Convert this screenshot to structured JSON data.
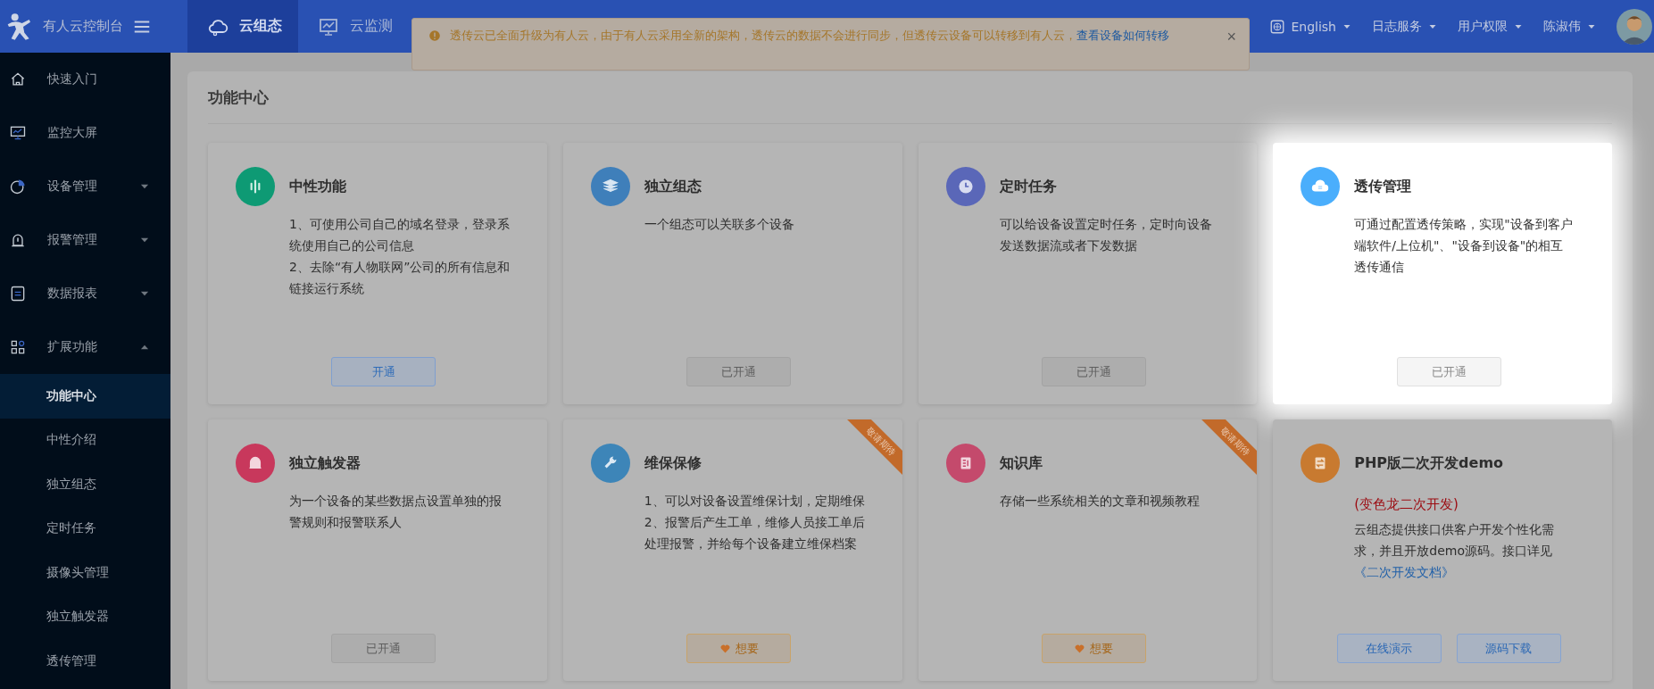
{
  "topbar": {
    "logo_text": "有人云控制台",
    "tabs": [
      {
        "label": "云组态",
        "selected": true
      },
      {
        "label": "云监测",
        "selected": false
      }
    ],
    "notice": {
      "text": "透传云已全面升级为有人云，由于有人云采用全新的架构，透传云的数据不会进行同步，但透传云设备可以转移到有人云，",
      "link": "查看设备如何转移",
      "close": "×"
    },
    "language": "English",
    "menus": [
      "日志服务",
      "用户权限",
      "陈淑伟"
    ]
  },
  "sidebar": {
    "items": [
      {
        "label": "快速入门"
      },
      {
        "label": "监控大屏"
      },
      {
        "label": "设备管理",
        "expanded": false
      },
      {
        "label": "报警管理",
        "expanded": false
      },
      {
        "label": "数据报表",
        "expanded": false
      },
      {
        "label": "扩展功能",
        "expanded": true,
        "children": [
          {
            "label": "功能中心",
            "selected": true
          },
          {
            "label": "中性介绍",
            "selected": false
          },
          {
            "label": "独立组态",
            "selected": false
          },
          {
            "label": "定时任务",
            "selected": false
          },
          {
            "label": "摄像头管理",
            "selected": false
          },
          {
            "label": "独立触发器",
            "selected": false
          },
          {
            "label": "透传管理",
            "selected": false
          }
        ]
      }
    ]
  },
  "page_title": "功能中心",
  "cards": [
    {
      "title": "中性功能",
      "color": "#0e9a74",
      "highlighted": false,
      "description": [
        "1、可使用公司自己的域名登录，登录系统使用自己的公司信息",
        "2、去除“有人物联网”公司的所有信息和链接运行系统"
      ],
      "buttons": [
        {
          "label": "开通",
          "kind": "open"
        }
      ]
    },
    {
      "title": "独立组态",
      "color": "#3f7fba",
      "highlighted": false,
      "description": [
        "一个组态可以关联多个设备"
      ],
      "buttons": [
        {
          "label": "已开通",
          "kind": "done"
        }
      ]
    },
    {
      "title": "定时任务",
      "color": "#5a67b8",
      "highlighted": false,
      "description": [
        "可以给设备设置定时任务，定时向设备发送数据流或者下发数据"
      ],
      "buttons": [
        {
          "label": "已开通",
          "kind": "done"
        }
      ]
    },
    {
      "title": "透传管理",
      "color": "#4aaefc",
      "highlighted": true,
      "description": [
        "可通过配置透传策略，实现\"设备到客户端软件/上位机\"、\"设备到设备\"的相互透传通信"
      ],
      "buttons": [
        {
          "label": "已开通",
          "kind": "done"
        }
      ]
    },
    {
      "title": "独立触发器",
      "color": "#c8385c",
      "highlighted": false,
      "description": [
        "为一个设备的某些数据点设置单独的报警规则和报警联系人"
      ],
      "buttons": [
        {
          "label": "已开通",
          "kind": "done"
        }
      ]
    },
    {
      "title": "维保保修",
      "color": "#3d85b8",
      "highlighted": false,
      "ribbon": "敬请期待",
      "description": [
        "1、可以对设备设置维保计划，定期维保",
        "2、报警后产生工单，维修人员接工单后处理报警，并给每个设备建立维保档案"
      ],
      "buttons": [
        {
          "label": "想要",
          "kind": "want"
        }
      ]
    },
    {
      "title": "知识库",
      "color": "#c44a6c",
      "highlighted": false,
      "ribbon": "敬请期待",
      "description": [
        "存储一些系统相关的文章和视频教程"
      ],
      "buttons": [
        {
          "label": "想要",
          "kind": "want"
        }
      ]
    },
    {
      "title": "PHP版二次开发demo",
      "subtitle": "(变色龙二次开发)",
      "color": "#c87a30",
      "highlighted": false,
      "description": [
        "云组态提供接口供客户开发个性化需求，并且开放demo源码。接口详见"
      ],
      "link": "《二次开发文档》",
      "buttons": [
        {
          "label": "在线演示",
          "kind": "link"
        },
        {
          "label": "源码下载",
          "kind": "link"
        }
      ]
    }
  ]
}
